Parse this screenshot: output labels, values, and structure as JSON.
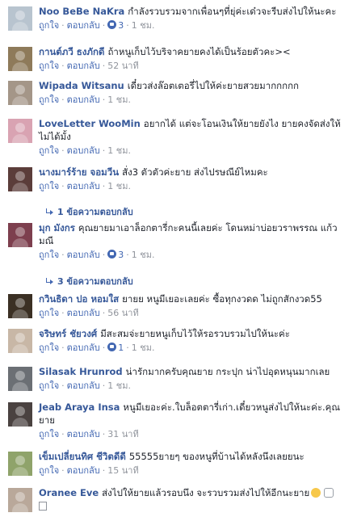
{
  "actions": {
    "like": "ถูกใจ",
    "reply": "ตอบกลับ"
  },
  "comments": [
    {
      "name": "Noo BeBe NaKra",
      "text": "กำลังรวบรวมจากเพื่อนๆที่ยุ่ค่ะเด๋วจะรีบส่งไปให้นะคะ",
      "likes": "3",
      "time": "1 ชม.",
      "avatar_color": "#b8c4cf"
    },
    {
      "name": "กานต์ภวี ธงภักดี",
      "text": "ถ้าหนูเก็บไว้บริจาคยายคงได้เป็นร้อยตัวคะ><",
      "likes": "",
      "time": "52 นาที",
      "avatar_color": "#8e7a5a"
    },
    {
      "name": "Wipada Witsanu",
      "text": "เดี๋ยวส่งล๊อตเตอรี่ไปให้ค่ะยายสวยมากกกกก",
      "likes": "",
      "time": "1 ชม.",
      "avatar_color": "#a49688"
    },
    {
      "name": "LoveLetter WooMin",
      "text": "อยากได้ แต่จะโอนเงินให้ยายยังไง ยายคงจัดส่งให้ไม่ได้มั้ง",
      "likes": "",
      "time": "1 ชม.",
      "avatar_color": "#d9a3b2"
    },
    {
      "name": "นางมาร์ร้าย จอมวีน",
      "text": "สั่ง3 ตัวตัวค่ะยาย ส่งไปรษณีย์ไหมคะ",
      "likes": "",
      "time": "1 ชม.",
      "avatar_color": "#5b3d3a",
      "replies": "1 ข้อความตอบกลับ"
    },
    {
      "name": "มุก มังกร",
      "text": "คุณยายมาเอาล็อกตารี่กะคนนี้เลยค่ะ โดนหม่าบ่อยวราพรรณ แก้วมณี",
      "likes": "3",
      "time": "1 ชม.",
      "avatar_color": "#7d3f4e",
      "replies": "3 ข้อความตอบกลับ"
    },
    {
      "name": "กวินธิดา ปอ หอมใส",
      "text": "ยายย หนูมีเยอะเลยค่ะ ซื้อทุกงวดด ไม่ถูกสักงวด55",
      "likes": "",
      "time": "56 นาที",
      "avatar_color": "#3b3024"
    },
    {
      "name": "จริษทร์ ชัยวงศ์",
      "text": "มีสะสมจ่ะยายหนูเก็บไว้ให้รอรวบรวมไปให้นะค่ะ",
      "likes": "1",
      "time": "1 ชม.",
      "avatar_color": "#c8b7a6"
    },
    {
      "name": "Silasak Hrunrod",
      "text": "น่ารักมากครับคุณยาย กระปุก น่าไปอุดหนุนมากเลย",
      "likes": "",
      "time": "1 ชม.",
      "avatar_color": "#6b6f74"
    },
    {
      "name": "Jeab Araya Insa",
      "text": "หนูมีเยอะค่ะ.ใบล็อตตารี่เก่า.เดี๋ยวหนูส่งไปให้นะค่ะ.คุณยาย",
      "likes": "",
      "time": "31 นาที",
      "avatar_color": "#4a4240"
    },
    {
      "name": "เข็มเปลี่ยนทิศ ชีวิตดีดี",
      "text": "55555ยายๆ ของหนูที่บ้านได้หลังนึงเลยยนะ",
      "likes": "",
      "time": "15 นาที",
      "avatar_color": "#8fa36a"
    },
    {
      "name": "Oranee Eve",
      "text": "ส่งไปให้ยายแล้วรอบนึง จะรวบรวมส่งไปให้อีกนะยาย",
      "likes": "",
      "time": "",
      "avatar_color": "#b9a89a"
    }
  ]
}
